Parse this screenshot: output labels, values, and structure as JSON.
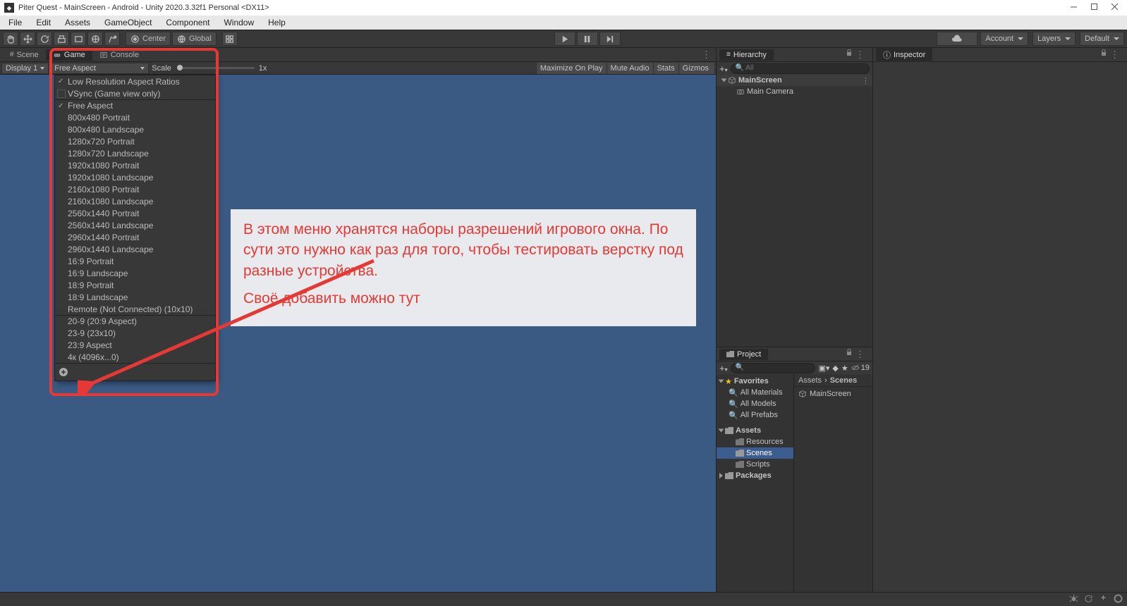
{
  "titlebar": {
    "title": "Piter Quest - MainScreen - Android - Unity 2020.3.32f1 Personal <DX11>"
  },
  "menu": {
    "items": [
      "File",
      "Edit",
      "Assets",
      "GameObject",
      "Component",
      "Window",
      "Help"
    ]
  },
  "toolbar": {
    "center": "Center",
    "global": "Global",
    "account": "Account",
    "layers": "Layers",
    "default": "Default"
  },
  "tabs_left": {
    "scene": "Scene",
    "game": "Game",
    "console": "Console"
  },
  "gamebar": {
    "display": "Display 1",
    "aspect": "Free Aspect",
    "scale": "Scale",
    "scaleval": "1x",
    "r": [
      "Maximize On Play",
      "Mute Audio",
      "Stats",
      "Gizmos"
    ]
  },
  "respanel": {
    "low": "Low Resolution Aspect Ratios",
    "vsync": "VSync (Game view only)",
    "items1": [
      "Free Aspect",
      "800x480 Portrait",
      "800x480 Landscape",
      "1280x720 Portrait",
      "1280x720 Landscape",
      "1920x1080 Portrait",
      "1920x1080 Landscape",
      "2160x1080 Portrait",
      "2160x1080 Landscape",
      "2560x1440 Portrait",
      "2560x1440 Landscape",
      "2960x1440 Portrait",
      "2960x1440 Landscape",
      "16:9 Portrait",
      "16:9 Landscape",
      "18:9 Portrait",
      "18:9 Landscape",
      "Remote (Not Connected) (10x10)"
    ],
    "items2": [
      "20-9 (20:9 Aspect)",
      "23-9 (23x10)",
      "23:9 Aspect",
      "4к (4096x...0)"
    ]
  },
  "callout": {
    "p1": "В этом меню хранятся наборы разрешений игрового окна. По сути это нужно как раз для того, чтобы тестировать верстку под разные устройства.",
    "p2": "Своё добавить можно тут"
  },
  "hierarchy": {
    "label": "Hierarchy",
    "search_ph": "All",
    "scene": "MainScreen",
    "camera": "Main Camera"
  },
  "project": {
    "label": "Project",
    "search_ph": "",
    "count": "19",
    "fav": "Favorites",
    "fav_items": [
      "All Materials",
      "All Models",
      "All Prefabs"
    ],
    "assets": "Assets",
    "asset_items": [
      "Resources",
      "Scenes",
      "Scripts"
    ],
    "packages": "Packages",
    "crumb_a": "Assets",
    "crumb_b": "Scenes",
    "file": "MainScreen"
  },
  "inspector": {
    "label": "Inspector"
  }
}
